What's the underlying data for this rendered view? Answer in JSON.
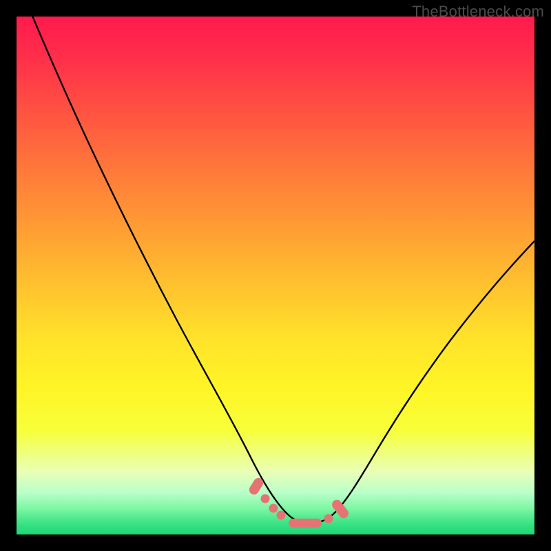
{
  "watermark": {
    "text": "TheBottleneck.com"
  },
  "colors": {
    "frame": "#000000",
    "curve_stroke": "#000000",
    "marker_fill": "#e57373",
    "marker_stroke": "#c85a5a"
  },
  "chart_data": {
    "type": "line",
    "title": "",
    "xlabel": "",
    "ylabel": "",
    "xlim": [
      0,
      100
    ],
    "ylim": [
      0,
      100
    ],
    "grid": false,
    "legend": false,
    "note": "Bottleneck curve — y is bottleneck percentage vs an implicit x axis. Values are read off the plotted curve; axes are unlabeled so x is normalized 0–100 and y is percent of plot height from bottom.",
    "series": [
      {
        "name": "bottleneck-curve",
        "x": [
          0,
          3,
          6,
          10,
          15,
          20,
          25,
          30,
          35,
          40,
          44,
          47,
          50,
          52,
          55,
          58,
          60,
          63,
          67,
          72,
          78,
          85,
          92,
          100
        ],
        "y": [
          103,
          95,
          87,
          77,
          65,
          54,
          44,
          35,
          27,
          19,
          13,
          8,
          4.5,
          3,
          2.2,
          2.2,
          3,
          5,
          9,
          16,
          25,
          36,
          47,
          59
        ]
      }
    ],
    "markers": {
      "note": "Coral dash/dot markers overlaid near the curve minimum.",
      "points": [
        {
          "x": 46.5,
          "y": 9.5,
          "shape": "cap-left"
        },
        {
          "x": 48.3,
          "y": 6.7,
          "shape": "dot"
        },
        {
          "x": 49.8,
          "y": 4.8,
          "shape": "dot"
        },
        {
          "x": 51.0,
          "y": 3.6,
          "shape": "dot"
        },
        {
          "x": 55.0,
          "y": 2.3,
          "shape": "bar-flat"
        },
        {
          "x": 60.0,
          "y": 3.2,
          "shape": "dot"
        },
        {
          "x": 62.8,
          "y": 5.4,
          "shape": "cap-right"
        }
      ]
    }
  }
}
